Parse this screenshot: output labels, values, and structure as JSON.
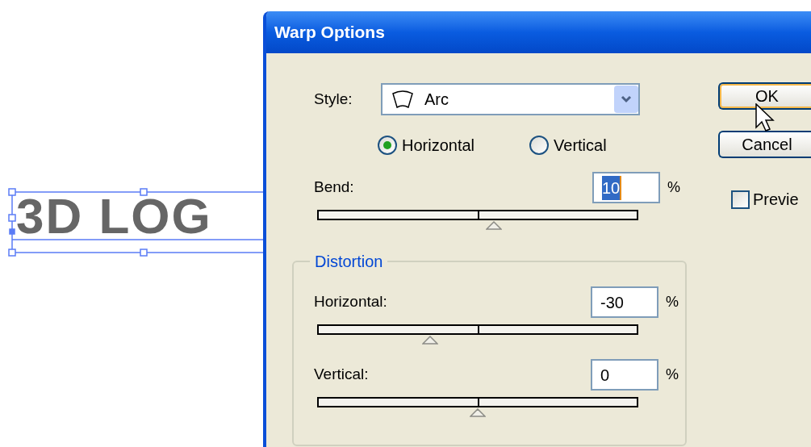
{
  "canvas": {
    "text": "3D LOG",
    "selected": true
  },
  "dialog": {
    "title": "Warp Options",
    "style": {
      "label": "Style:",
      "value": "Arc"
    },
    "orientation": [
      {
        "label": "Horizontal",
        "selected": true
      },
      {
        "label": "Vertical",
        "selected": false
      }
    ],
    "bend": {
      "label": "Bend:",
      "value": "10",
      "unit": "%",
      "level": 0.55,
      "value_selected": true
    },
    "distortion": {
      "title": "Distortion",
      "sliders": [
        {
          "label": "Horizontal:",
          "value": "-30",
          "unit": "%",
          "level": 0.35
        },
        {
          "label": "Vertical:",
          "value": "0",
          "unit": "%",
          "level": 0.5
        }
      ]
    },
    "buttons": [
      {
        "label": "OK",
        "default": true
      },
      {
        "label": "Cancel",
        "default": false
      }
    ],
    "preview": {
      "label": "Previe",
      "checked": false
    }
  }
}
